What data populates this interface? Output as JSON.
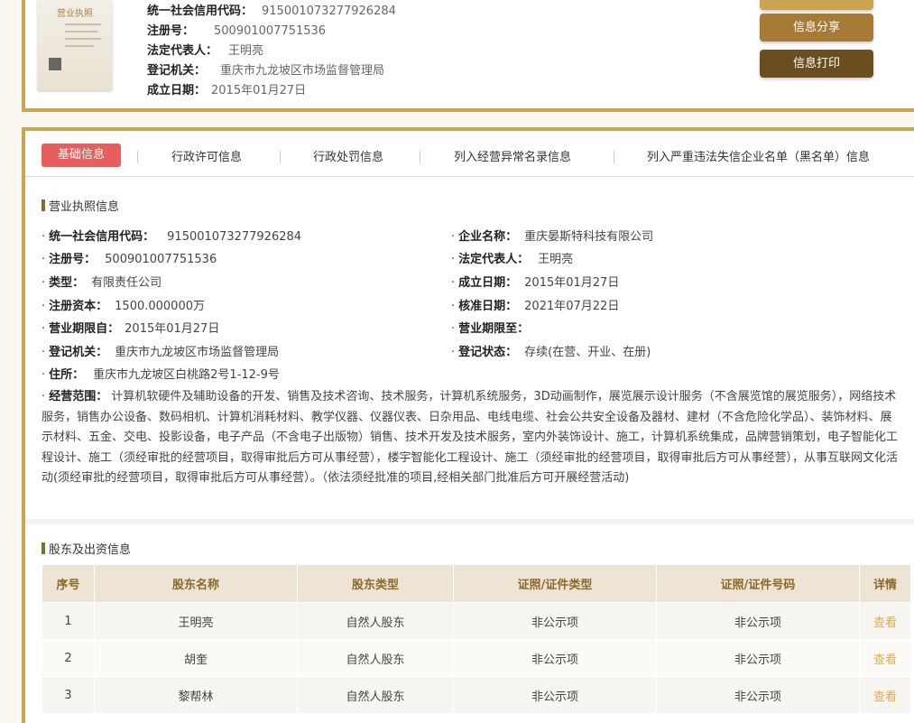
{
  "summary": {
    "license_thumb_title": "营业执照",
    "credit_code_label": "统一社会信用代码：",
    "credit_code": "915001073277926284",
    "reg_no_label": "注册号：",
    "reg_no": "500901007751536",
    "legal_rep_label": "法定代表人：",
    "legal_rep": "王明亮",
    "authority_label": "登记机关：",
    "authority": "重庆市九龙坡区市场监督管理局",
    "established_label": "成立日期：",
    "established": "2015年01月27日"
  },
  "actions": {
    "share": "信息分享",
    "print": "信息打印"
  },
  "tabs": [
    "基础信息",
    "行政许可信息",
    "行政处罚信息",
    "列入经营异常名录信息",
    "列入严重违法失信企业名单（黑名单）信息"
  ],
  "license_section": {
    "title": "营业执照信息",
    "left": [
      {
        "label": "统一社会信用代码：",
        "value": "915001073277926284"
      },
      {
        "label": "注册号：",
        "value": "500901007751536"
      },
      {
        "label": "类型：",
        "value": "有限责任公司"
      },
      {
        "label": "注册资本：",
        "value": "1500.000000万"
      },
      {
        "label": "营业期限自：",
        "value": "2015年01月27日"
      },
      {
        "label": "登记机关：",
        "value": "重庆市九龙坡区市场监督管理局"
      },
      {
        "label": "住所：",
        "value": "重庆市九龙坡区白桃路2号1-12-9号"
      }
    ],
    "right": [
      {
        "label": "企业名称：",
        "value": "重庆晏斯特科技有限公司"
      },
      {
        "label": "法定代表人：",
        "value": "王明亮"
      },
      {
        "label": "成立日期：",
        "value": "2015年01月27日"
      },
      {
        "label": "核准日期：",
        "value": "2021年07月22日"
      },
      {
        "label": "营业期限至：",
        "value": ""
      },
      {
        "label": "登记状态：",
        "value": "存续(在营、开业、在册)"
      }
    ],
    "scope_label": "经营范围：",
    "scope": "计算机软硬件及辅助设备的开发、销售及技术咨询、技术服务，计算机系统服务，3D动画制作，展览展示设计服务（不含展览馆的展览服务），网络技术服务，销售办公设备、数码相机、计算机消耗材料、教学仪器、仪器仪表、日杂用品、电线电缆、社会公共安全设备及器材、建材（不含危险化学品）、装饰材料、展示材料、五金、交电、投影设备，电子产品（不含电子出版物）销售、技术开发及技术服务，室内外装饰设计、施工，计算机系统集成，品牌营销策划，电子智能化工程设计、施工（须经审批的经营项目，取得审批后方可从事经营），楼宇智能化工程设计、施工（须经审批的经营项目，取得审批后方可从事经营），从事互联网文化活动(须经审批的经营项目，取得审批后方可从事经营）。（依法须经批准的项目,经相关部门批准后方可开展经营活动)"
  },
  "shareholders": {
    "title": "股东及出资信息",
    "columns": [
      "序号",
      "股东名称",
      "股东类型",
      "证照/证件类型",
      "证照/证件号码",
      "详情"
    ],
    "rows": [
      [
        "1",
        "王明亮",
        "自然人股东",
        "非公示项",
        "非公示项",
        "查看"
      ],
      [
        "2",
        "胡奎",
        "自然人股东",
        "非公示项",
        "非公示项",
        "查看"
      ],
      [
        "3",
        "黎帮林",
        "自然人股东",
        "非公示项",
        "非公示项",
        "查看"
      ]
    ]
  },
  "colors": {
    "gold_border": "#c9a552",
    "share_button": "#a77a35",
    "print_button": "#6b4e20",
    "active_tab": "#e85d5d",
    "link": "#e3a852"
  }
}
